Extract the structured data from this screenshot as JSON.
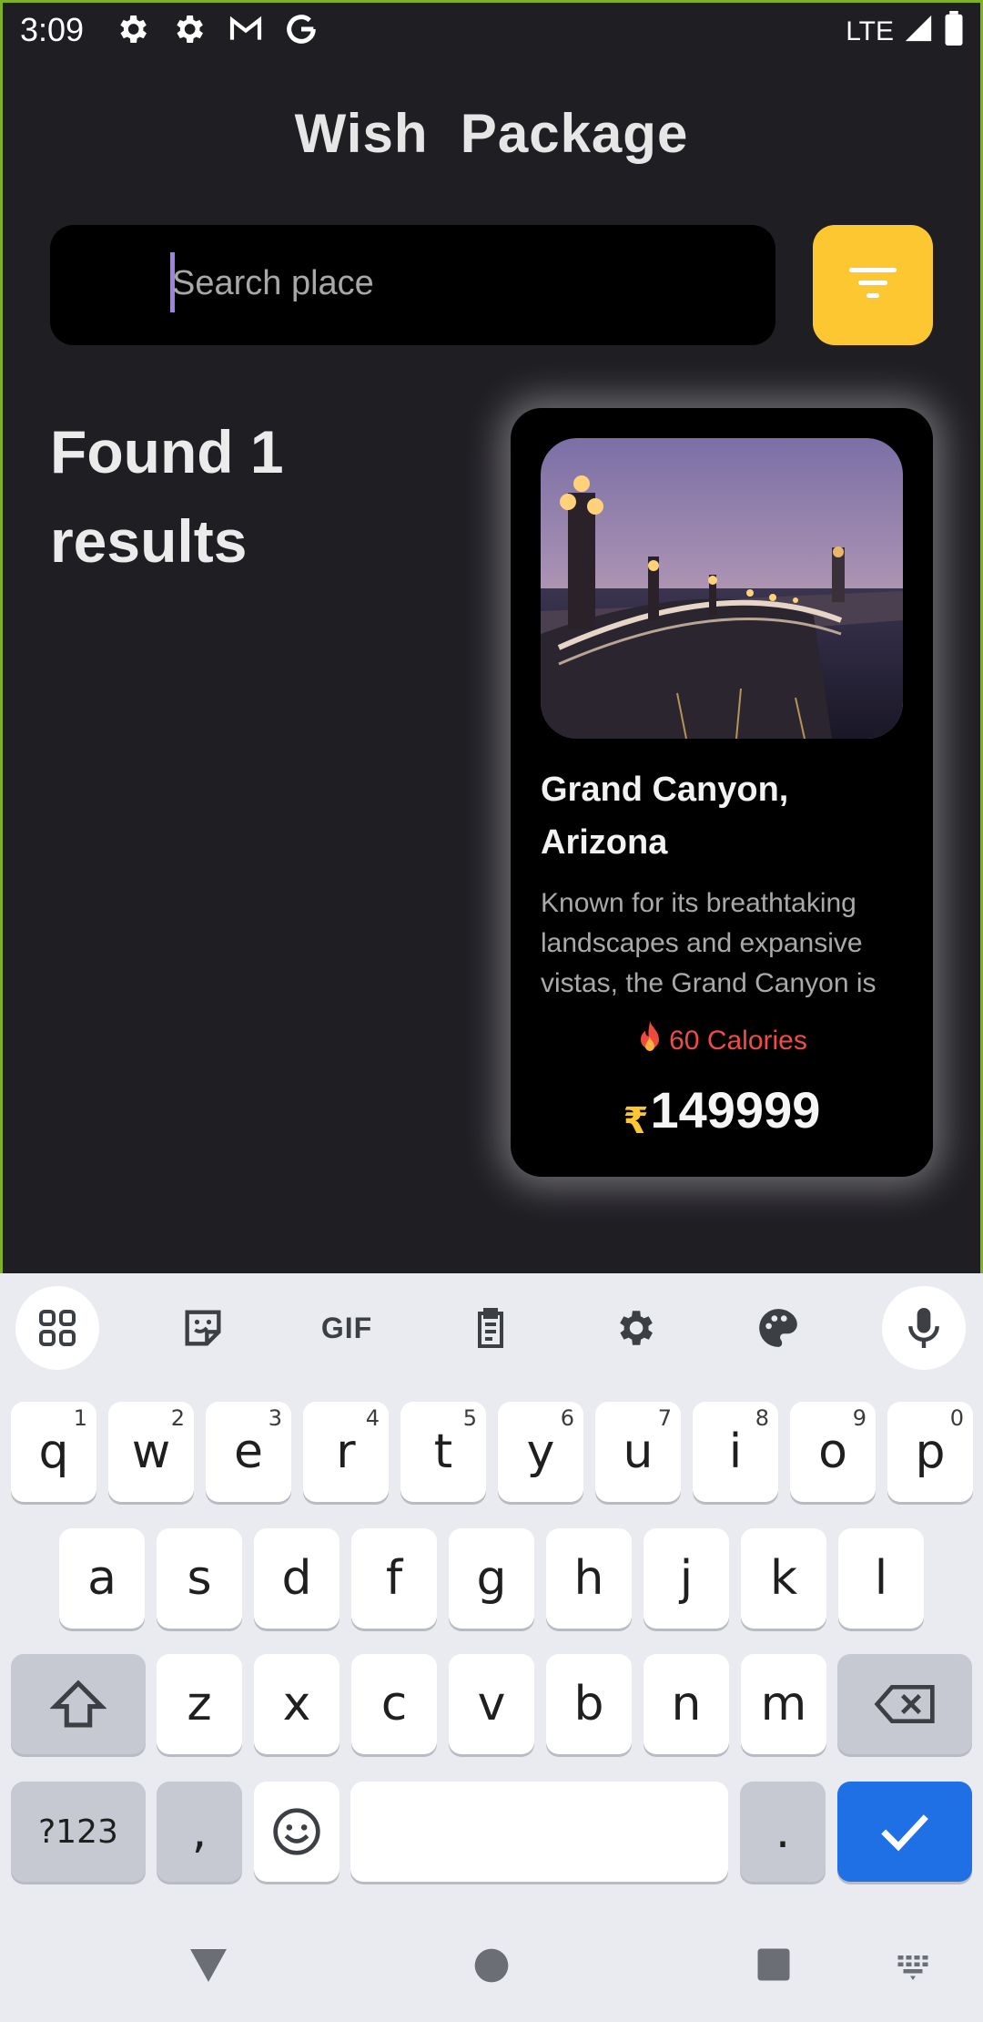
{
  "status_bar": {
    "time": "3:09",
    "network": "LTE",
    "icons": [
      "settings-icon",
      "settings-icon",
      "gmail-icon",
      "google-icon",
      "signal-icon",
      "battery-icon"
    ]
  },
  "header": {
    "title": "Wish  Package"
  },
  "search": {
    "placeholder": "Search place",
    "value": ""
  },
  "filter_button": {
    "icon": "filter-icon",
    "color": "#fdc731"
  },
  "results": {
    "text": "Found 1 results"
  },
  "card": {
    "image": "paris-bridge-night-photo",
    "title": "Grand Canyon, Arizona",
    "description": "Known for its breathtaking landscapes and expansive vistas, the Grand Canyon is",
    "calories_icon": "fire-icon",
    "calories": "60 Calories",
    "currency": "₹",
    "price": "149999"
  },
  "keyboard": {
    "toolbar": [
      "apps-grid-icon",
      "sticker-icon",
      "GIF",
      "clipboard-icon",
      "settings-icon",
      "palette-icon",
      "mic-icon"
    ],
    "gif_label": "GIF",
    "row1": [
      {
        "k": "q",
        "h": "1"
      },
      {
        "k": "w",
        "h": "2"
      },
      {
        "k": "e",
        "h": "3"
      },
      {
        "k": "r",
        "h": "4"
      },
      {
        "k": "t",
        "h": "5"
      },
      {
        "k": "y",
        "h": "6"
      },
      {
        "k": "u",
        "h": "7"
      },
      {
        "k": "i",
        "h": "8"
      },
      {
        "k": "o",
        "h": "9"
      },
      {
        "k": "p",
        "h": "0"
      }
    ],
    "row2": [
      "a",
      "s",
      "d",
      "f",
      "g",
      "h",
      "j",
      "k",
      "l"
    ],
    "row3": [
      "z",
      "x",
      "c",
      "v",
      "b",
      "n",
      "m"
    ],
    "sym_label": "?123",
    "comma": ",",
    "period": ".",
    "accent_color": "#1f6fe5"
  },
  "nav": [
    "back-icon",
    "home-icon",
    "recents-icon",
    "keyboard-switch-icon"
  ]
}
